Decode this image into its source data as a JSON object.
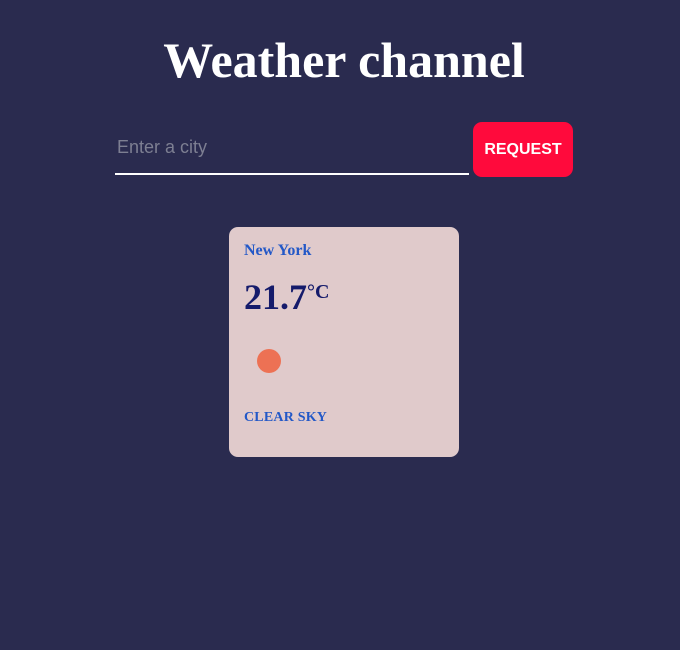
{
  "header": {
    "title": "Weather channel"
  },
  "search": {
    "value": "",
    "placeholder": "Enter a city",
    "button_label": "REQUEST"
  },
  "weather_card": {
    "city": "New York",
    "temperature": "21.7",
    "unit": "°C",
    "icon": "sun-icon",
    "icon_color": "#ed7154",
    "description": "CLEAR SKY"
  },
  "colors": {
    "background": "#2a2b4f",
    "accent": "#ff0a3c",
    "card": "#e0cacb",
    "city_text": "#2358c7",
    "temperature_text": "#151b6b"
  }
}
